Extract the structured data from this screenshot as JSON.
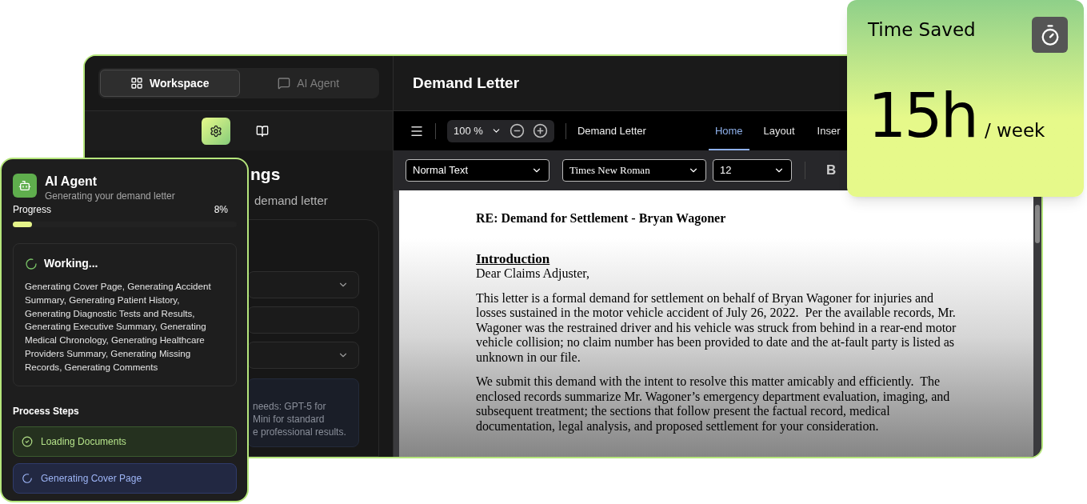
{
  "workspace": {
    "tabs": [
      {
        "label": "Workspace",
        "kind": "grid",
        "selected": true
      },
      {
        "label": "AI Agent",
        "kind": "chat",
        "selected": false
      }
    ],
    "tool_tabs": [
      {
        "kind": "settings",
        "selected": true
      },
      {
        "kind": "book",
        "selected": false
      }
    ],
    "heading": "ngs",
    "subtitle": "demand letter",
    "fields": [
      {
        "kind": "select"
      },
      {
        "kind": "input"
      },
      {
        "kind": "select"
      }
    ],
    "info_lines": [
      "needs: GPT-5 for",
      "Mini for standard",
      "e professional results."
    ]
  },
  "editor": {
    "title": "Demand Letter",
    "zoom": "100 %",
    "doc_name": "Demand Letter",
    "tabs": [
      {
        "label": "Home",
        "selected": true
      },
      {
        "label": "Layout",
        "selected": false
      },
      {
        "label": "Inser",
        "selected": false
      }
    ],
    "style": "Normal Text",
    "font": "Times New Roman",
    "size": "12",
    "bold": "B",
    "document": {
      "subject": "RE: Demand for Settlement - Bryan Wagoner",
      "heading": "Introduction",
      "salutation": "Dear Claims Adjuster,",
      "paragraphs": [
        "This letter is a formal demand for settlement on behalf of Bryan Wagoner for injuries and losses sustained in the motor vehicle accident of July 26, 2022.  Per the available records, Mr. Wagoner was the restrained driver and his vehicle was struck from behind in a rear-end motor vehicle collision; no claim number has been provided to date and the at-fault party is listed as unknown in our file.",
        "We submit this demand with the intent to resolve this matter amicably and efficiently.  The enclosed records summarize Mr. Wagoner’s emergency department evaluation, imaging, and subsequent treatment; the sections that follow present the factual record, medical documentation, legal analysis, and proposed settlement for your consideration."
      ]
    }
  },
  "agent": {
    "title": "AI Agent",
    "subtitle": "Generating your demand letter",
    "progress": {
      "label": "Progress",
      "reading": "8%",
      "level": 0.085
    },
    "working": {
      "title": "Working...",
      "text": "Generating Cover Page, Generating Accident Summary, Generating Patient History, Generating Diagnostic Tests and Results, Generating Executive Summary, Generating Medical Chronology, Generating Healthcare Providers Summary, Generating Missing Records, Generating Comments"
    },
    "steps_title": "Process Steps",
    "steps": [
      {
        "label": "Loading Documents",
        "kind": "done"
      },
      {
        "label": "Generating Cover Page",
        "kind": "active"
      }
    ]
  },
  "time_saved": {
    "title": "Time Saved",
    "value": "15h",
    "unit": "/ week"
  }
}
